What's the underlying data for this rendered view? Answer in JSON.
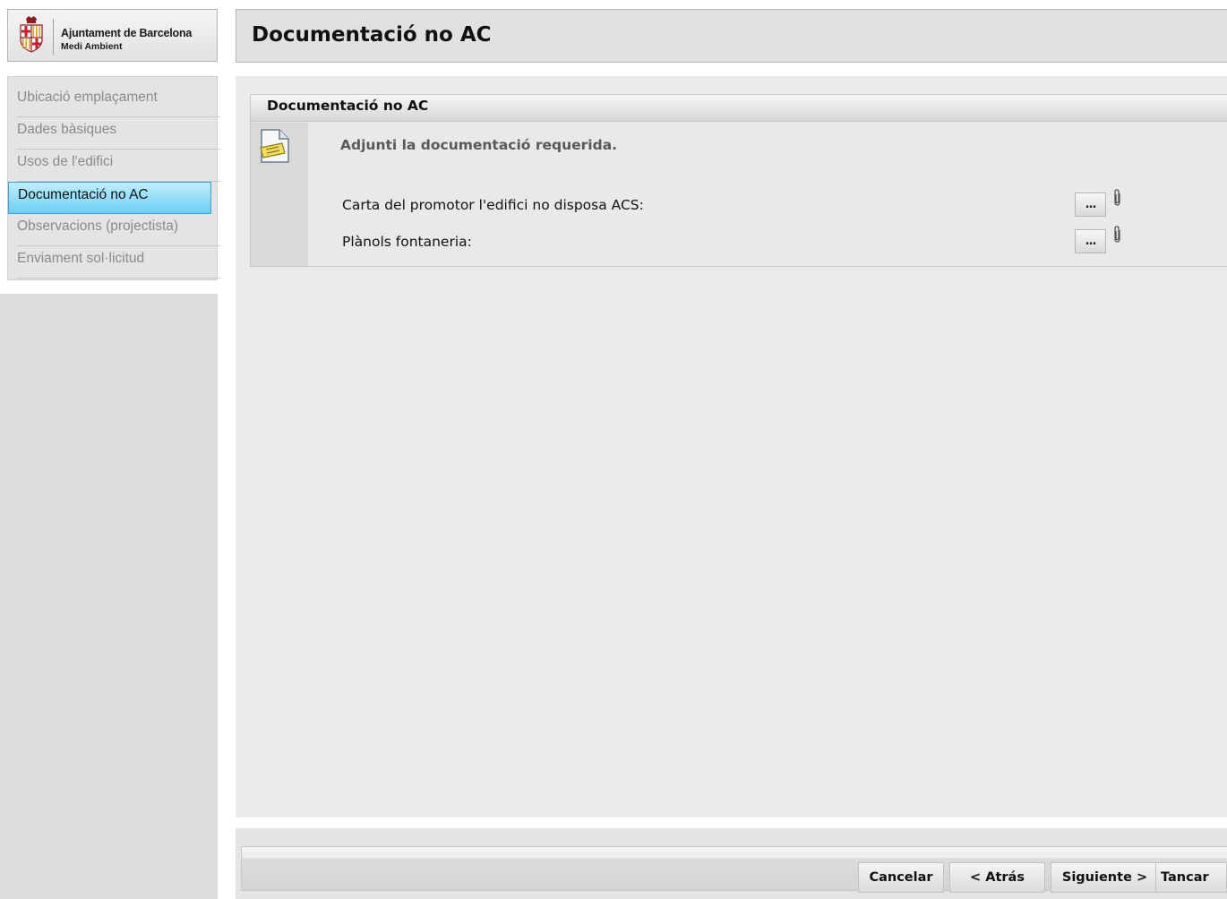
{
  "brand": {
    "title": "Ajuntament de Barcelona",
    "subtitle": "Medi Ambient",
    "logo_icon": "barcelona-crest-icon"
  },
  "sidebar": {
    "items": [
      {
        "label": "Ubicació emplaçament",
        "active": false
      },
      {
        "label": "Dades bàsiques",
        "active": false
      },
      {
        "label": "Usos de l'edifici",
        "active": false
      },
      {
        "label": "Documentació no AC",
        "active": true
      },
      {
        "label": "Observacions (projectista)",
        "active": false
      },
      {
        "label": "Enviament sol·licitud",
        "active": false
      }
    ],
    "active_color": "#6ccdf5"
  },
  "header": {
    "title": "Documentació no AC"
  },
  "panel": {
    "title": "Documentació no AC",
    "icon": "document-note-icon",
    "intro": "Adjunti la documentació requerida.",
    "fields": [
      {
        "label": "Carta del promotor l'edifici no disposa ACS:",
        "button_label": "...",
        "icon": "paperclip-icon"
      },
      {
        "label": "Plànols fontaneria:",
        "button_label": "...",
        "icon": "paperclip-icon"
      }
    ]
  },
  "footer": {
    "buttons": [
      {
        "label": "Cancelar"
      },
      {
        "label": "< Atrás"
      },
      {
        "label": "Siguiente >"
      },
      {
        "label": "Tancar"
      }
    ]
  }
}
